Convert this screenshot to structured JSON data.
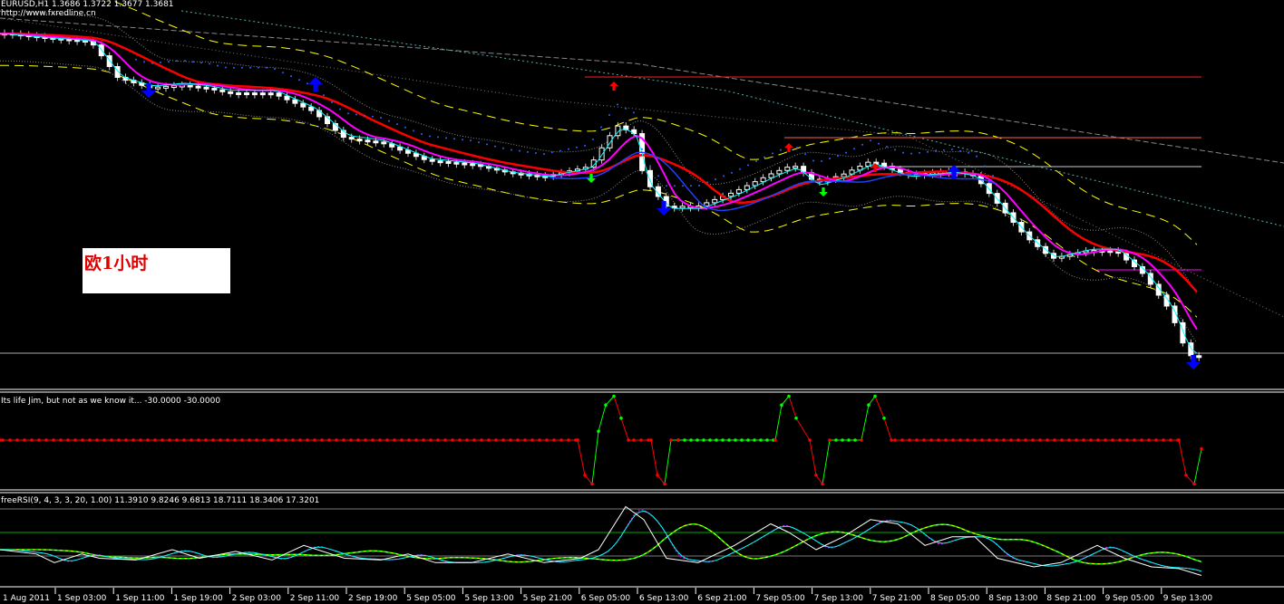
{
  "header": {
    "symbol_line": "EURUSD,H1  1.3686 1.3722 1.3677 1.3681",
    "url": "http://www.fxredline.cn"
  },
  "overlay_label": "欧1小时",
  "indicator1": {
    "title": "Its life Jim, but not as we know it...  -30.0000 -30.0000"
  },
  "indicator2": {
    "title": "freeRSI(9, 4, 3, 3, 20, 1.00) 11.3910 9.8246 9.6813 18.7111 18.3406 17.3201"
  },
  "time_axis": [
    "1 Aug 2011",
    "1 Sep 03:00",
    "1 Sep 11:00",
    "1 Sep 19:00",
    "2 Sep 03:00",
    "2 Sep 11:00",
    "2 Sep 19:00",
    "5 Sep 05:00",
    "5 Sep 13:00",
    "5 Sep 21:00",
    "6 Sep 05:00",
    "6 Sep 13:00",
    "6 Sep 21:00",
    "7 Sep 05:00",
    "7 Sep 13:00",
    "7 Sep 21:00",
    "8 Sep 05:00",
    "8 Sep 13:00",
    "8 Sep 21:00",
    "9 Sep 05:00",
    "9 Sep 13:00"
  ],
  "colors": {
    "up": "#ffffff",
    "down": "#ffffff",
    "ma_fast": "#ff00ff",
    "ma_slow": "#ff0000",
    "signal_cyan": "#00ffff",
    "band": "#ffff00",
    "arrow_buy": "#0000ff",
    "arrow_alt": "#00ff00",
    "arrow_sell": "#ff0000"
  },
  "chart_data": {
    "type": "line",
    "title": "EURUSD,H1",
    "last_price": 1.3681,
    "price_series": [
      1.4294,
      1.4287,
      1.4281,
      1.4212,
      1.4194,
      1.42,
      1.4194,
      1.4186,
      1.4186,
      1.4151,
      1.4099,
      1.409,
      1.4055,
      1.4046,
      1.4029,
      1.402,
      1.4038,
      1.4116,
      1.4099,
      1.4012,
      1.3959,
      1.3959,
      1.3986,
      1.402,
      1.4038,
      1.4003,
      1.402,
      1.4046,
      1.402,
      1.4029,
      1.402,
      1.3968,
      1.3907,
      1.3864,
      1.3881,
      1.3881,
      1.3838,
      1.3768,
      1.3681,
      1.3681
    ],
    "jim_series": [
      -30,
      -30,
      -30,
      -30,
      -70,
      -80,
      -20,
      10,
      20,
      -5,
      -30,
      -30,
      -70,
      -80,
      -30,
      -30,
      -30,
      10,
      20,
      -5,
      -30,
      -70,
      -80,
      -30,
      -30,
      10,
      20,
      -5,
      -30,
      -30,
      -70,
      -80,
      -40
    ],
    "rsi_series": [
      40,
      35,
      25,
      35,
      30,
      28,
      40,
      30,
      38,
      28,
      45,
      30,
      28,
      35,
      25,
      25,
      35,
      25,
      30,
      40,
      90,
      75,
      30,
      25,
      45,
      70,
      60,
      40,
      55,
      75,
      70,
      45,
      55,
      55,
      30,
      20,
      25,
      45,
      30,
      20,
      18,
      10
    ]
  }
}
